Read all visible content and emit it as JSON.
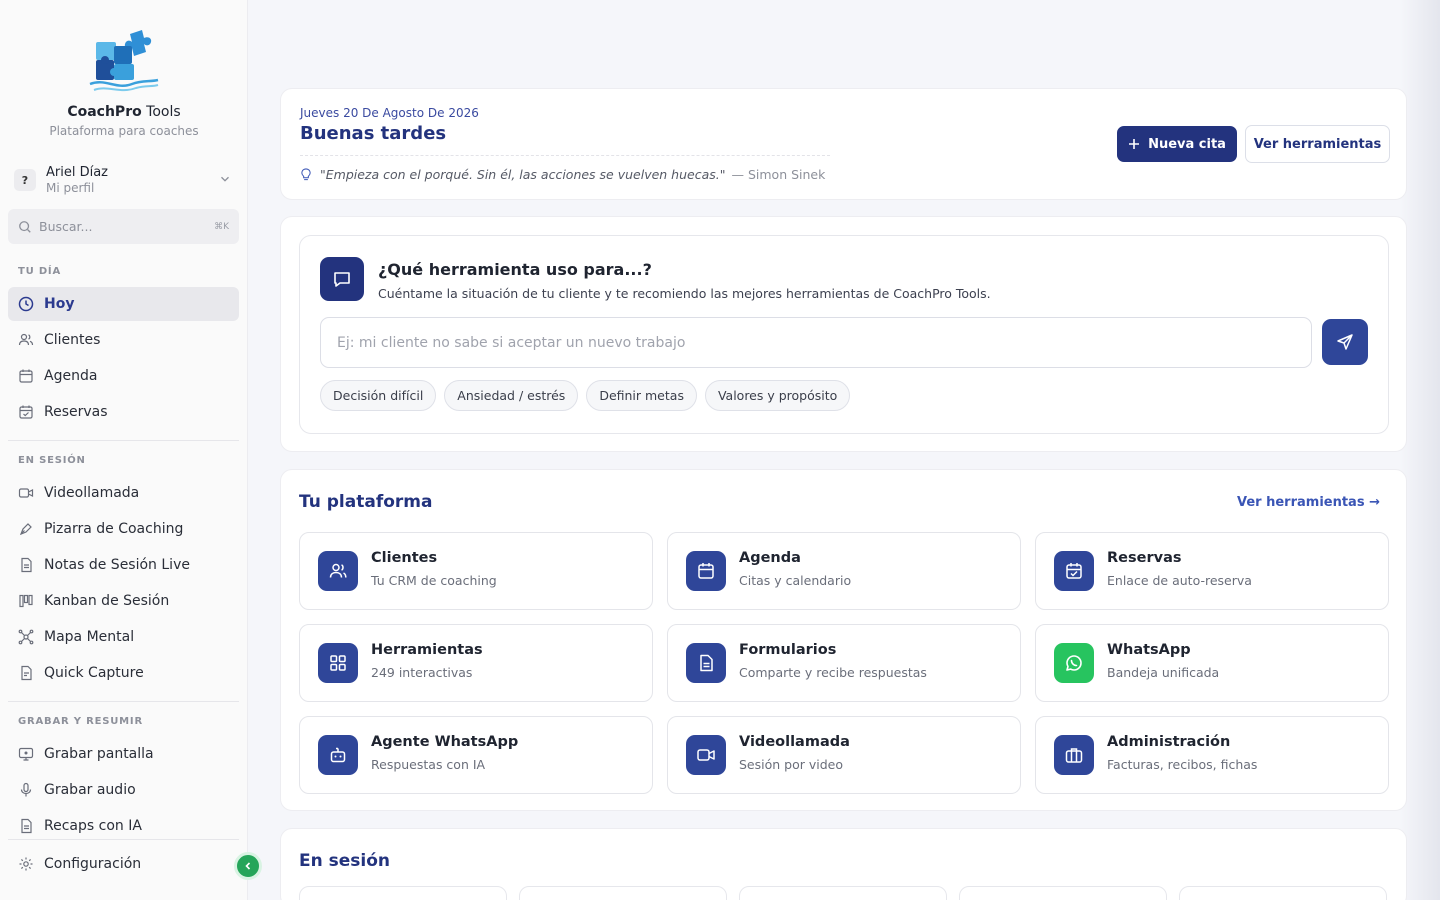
{
  "sidebar": {
    "brand_bold": "CoachPro",
    "brand_thin": " Tools",
    "brand_sub": "Plataforma para coaches",
    "profile": {
      "avatar": "?",
      "name": "Ariel Díaz",
      "sub": "Mi perfil"
    },
    "search": {
      "placeholder": "Buscar...",
      "shortcut": "⌘K"
    },
    "sections": {
      "tu_dia": "TU DÍA",
      "en_sesion": "EN SESIÓN",
      "grabar": "GRABAR Y RESUMIR"
    },
    "items": {
      "hoy": "Hoy",
      "clientes": "Clientes",
      "agenda": "Agenda",
      "reservas": "Reservas",
      "videollamada": "Videollamada",
      "pizarra": "Pizarra de Coaching",
      "notas": "Notas de Sesión Live",
      "kanban": "Kanban de Sesión",
      "mapa": "Mapa Mental",
      "quick": "Quick Capture",
      "grabar_pantalla": "Grabar pantalla",
      "grabar_audio": "Grabar audio",
      "recaps": "Recaps con IA",
      "config": "Configuración"
    }
  },
  "header": {
    "date": "Jueves 20 De Agosto De 2026",
    "greeting": "Buenas tardes",
    "quote": "\"Empieza con el porqué. Sin él, las acciones se vuelven huecas.\"",
    "quote_author": "— Simon Sinek",
    "new_appointment": "Nueva cita",
    "view_tools": "Ver herramientas"
  },
  "ask": {
    "title": "¿Qué herramienta uso para...?",
    "subtitle": "Cuéntame la situación de tu cliente y te recomiendo las mejores herramientas de CoachPro Tools.",
    "placeholder": "Ej: mi cliente no sabe si aceptar un nuevo trabajo",
    "chips": [
      "Decisión difícil",
      "Ansiedad / estrés",
      "Definir metas",
      "Valores y propósito"
    ]
  },
  "platform": {
    "title": "Tu plataforma",
    "link": "Ver herramientas →",
    "tiles": [
      {
        "name": "Clientes",
        "desc": "Tu CRM de coaching",
        "icon": "users-icon"
      },
      {
        "name": "Agenda",
        "desc": "Citas y calendario",
        "icon": "calendar-icon"
      },
      {
        "name": "Reservas",
        "desc": "Enlace de auto-reserva",
        "icon": "calendar-check-icon"
      },
      {
        "name": "Herramientas",
        "desc": "249 interactivas",
        "icon": "grid-icon"
      },
      {
        "name": "Formularios",
        "desc": "Comparte y recibe respuestas",
        "icon": "file-text-icon"
      },
      {
        "name": "WhatsApp",
        "desc": "Bandeja unificada",
        "icon": "whatsapp-icon"
      },
      {
        "name": "Agente WhatsApp",
        "desc": "Respuestas con IA",
        "icon": "bot-icon"
      },
      {
        "name": "Videollamada",
        "desc": "Sesión por video",
        "icon": "video-icon"
      },
      {
        "name": "Administración",
        "desc": "Facturas, recibos, fichas",
        "icon": "briefcase-icon"
      }
    ]
  },
  "session": {
    "title": "En sesión"
  },
  "colors": {
    "primary": "#23337e",
    "accent": "#2f4699",
    "whatsapp": "#27c45f",
    "collapse": "#25a55a"
  }
}
